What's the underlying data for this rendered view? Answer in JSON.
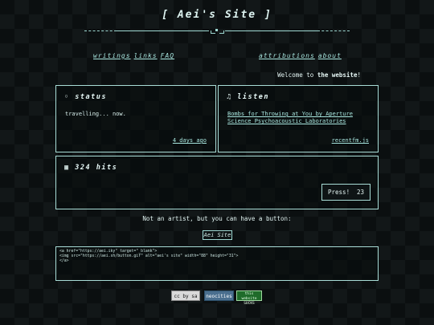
{
  "header": {
    "title": "[ Aei's Site ]"
  },
  "nav": {
    "left": [
      "writings",
      "links",
      "FAQ"
    ],
    "right": [
      "attributions",
      "about"
    ]
  },
  "welcome": {
    "prefix": "Welcome to",
    "emphasis": "the website",
    "suffix": "!"
  },
  "status": {
    "heading": "status",
    "text": "travelling... now.",
    "time": "4 days ago"
  },
  "listen": {
    "heading": "listen",
    "song": "Bombs for Throwing at You by Aperture Science Psychoacoustic Laboratories",
    "source": "recentfm.js"
  },
  "hits": {
    "count": "324",
    "label": "hits",
    "button_label": "Press!",
    "button_count": "23"
  },
  "button_section": {
    "caption": "Not an artist, but you can have a button:",
    "badge_label": "Aei Site",
    "code": "<a href=\"https://aei.iky\" target=\"_blank\">\n<img src=\"https://aei.sh/button.gif\" alt=\"aei's site\" width=\"88\" height=\"31\">\n</a>"
  },
  "footer": {
    "badges": [
      "cc by sa",
      "neocities",
      "this website SUCKS"
    ]
  },
  "colors": {
    "accent": "#a9ddd7",
    "background": "#0b0f10"
  }
}
